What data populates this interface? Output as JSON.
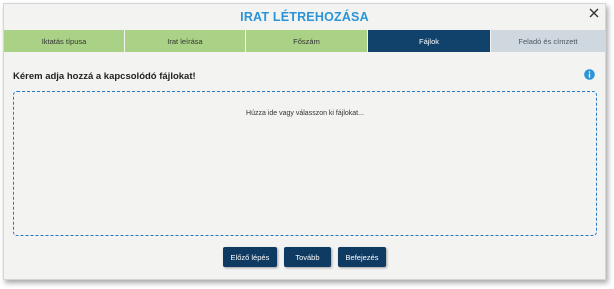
{
  "dialog": {
    "title": "IRAT LÉTREHOZÁSA",
    "close_icon": "close-icon"
  },
  "steps": [
    {
      "label": "Iktatás típusa",
      "state": "done"
    },
    {
      "label": "Irat leírása",
      "state": "done"
    },
    {
      "label": "Főszám",
      "state": "done"
    },
    {
      "label": "Fájlok",
      "state": "active"
    },
    {
      "label": "Feladó és címzett",
      "state": "todo"
    }
  ],
  "files": {
    "heading": "Kérem adja hozzá a kapcsolódó fájlokat!",
    "info_icon": "info-icon",
    "drop_hint": "Húzza ide vagy válasszon ki fájlokat..."
  },
  "buttons": {
    "prev": "Előző lépés",
    "next": "Tovább",
    "finish": "Befejezés"
  },
  "colors": {
    "title": "#2a94d6",
    "step_done": "#a9d286",
    "step_active": "#11426b",
    "step_todo": "#cfd7df",
    "button": "#0f3b62",
    "dropzone_border": "#2a78c2"
  }
}
